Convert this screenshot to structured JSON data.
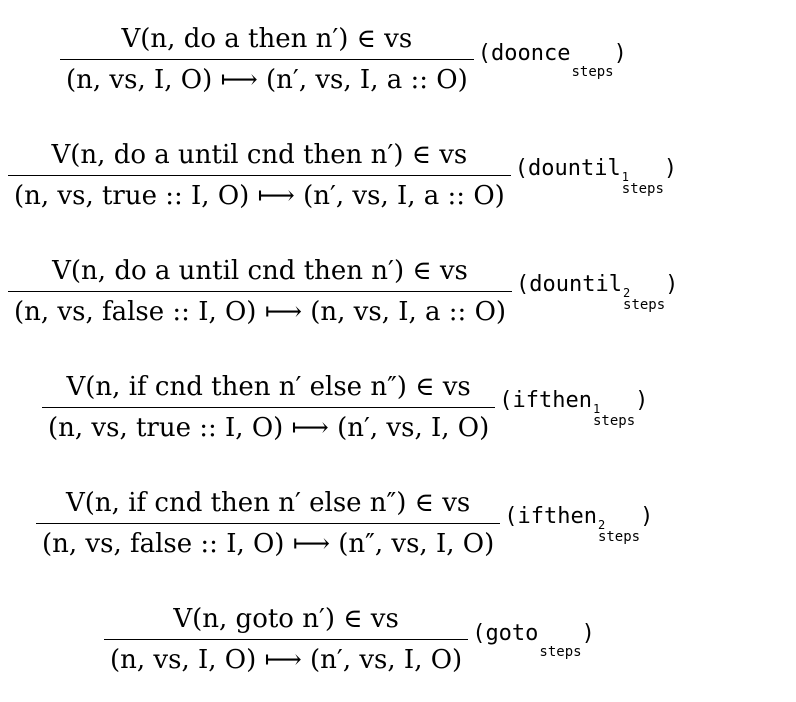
{
  "rules": [
    {
      "premise": "V(n, do a then n′) ∈ vs",
      "conclusion": "(n, vs, I, O) ⟼ (n′, vs, I, a :: O)",
      "label_name": "doonce",
      "label_sup": "",
      "label_sub": "steps"
    },
    {
      "premise": "V(n, do a until cnd then n′) ∈ vs",
      "conclusion": "(n, vs, true :: I, O) ⟼ (n′, vs, I, a :: O)",
      "label_name": "dountil",
      "label_sup": "1",
      "label_sub": "steps"
    },
    {
      "premise": "V(n, do a until cnd then n′) ∈ vs",
      "conclusion": "(n, vs, false :: I, O) ⟼ (n, vs, I, a :: O)",
      "label_name": "dountil",
      "label_sup": "2",
      "label_sub": "steps"
    },
    {
      "premise": "V(n, if cnd then n′ else n″) ∈ vs",
      "conclusion": "(n, vs, true :: I, O) ⟼ (n′, vs, I, O)",
      "label_name": "ifthen",
      "label_sup": "1",
      "label_sub": "steps"
    },
    {
      "premise": "V(n, if cnd then n′ else n″) ∈ vs",
      "conclusion": "(n, vs, false :: I, O) ⟼ (n″, vs, I, O)",
      "label_name": "ifthen",
      "label_sup": "2",
      "label_sub": "steps"
    },
    {
      "premise": "V(n, goto n′) ∈ vs",
      "conclusion": "(n, vs, I, O) ⟼ (n′, vs, I, O)",
      "label_name": "goto",
      "label_sup": "",
      "label_sub": "steps"
    }
  ]
}
